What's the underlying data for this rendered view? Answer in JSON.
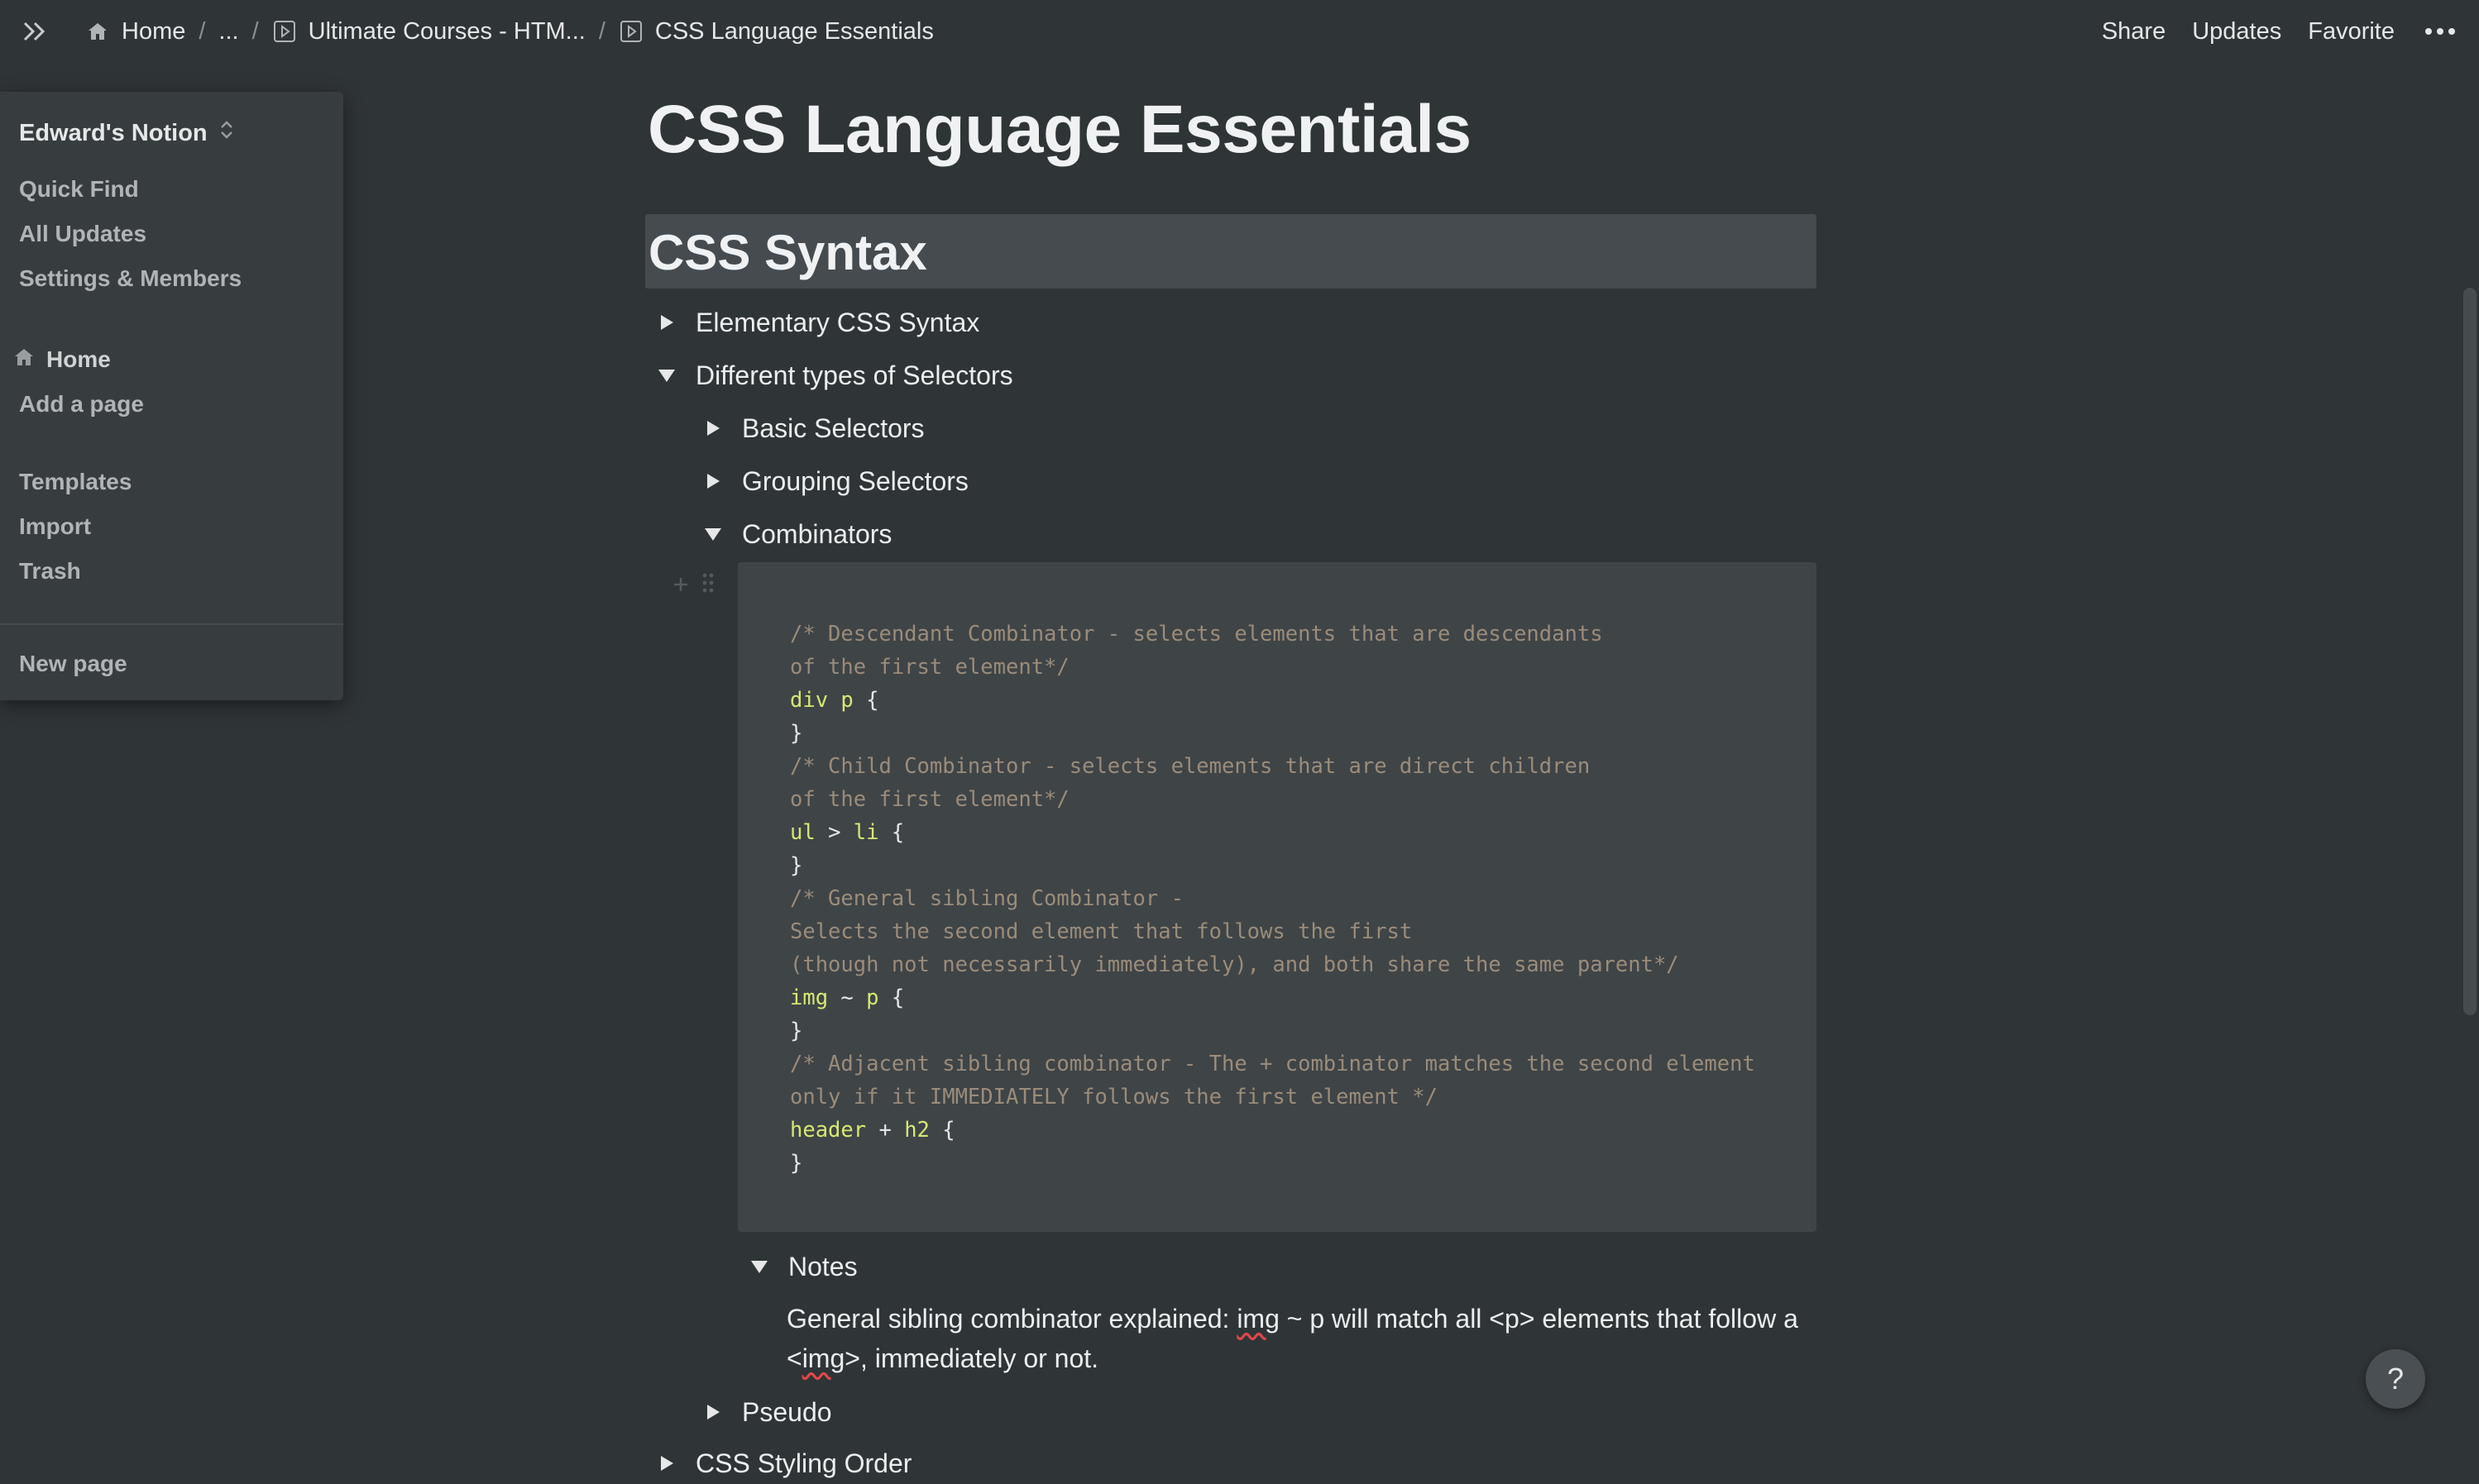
{
  "breadcrumb": {
    "home": "Home",
    "ellipsis": "...",
    "parent": "Ultimate Courses - HTM...",
    "current": "CSS Language Essentials",
    "separator": "/"
  },
  "topbar_actions": {
    "share": "Share",
    "updates": "Updates",
    "favorite": "Favorite"
  },
  "sidebar": {
    "workspace": "Edward's Notion",
    "quick_find": "Quick Find",
    "all_updates": "All Updates",
    "settings": "Settings & Members",
    "home": "Home",
    "add_page": "Add a page",
    "templates": "Templates",
    "import": "Import",
    "trash": "Trash",
    "new_page": "New page"
  },
  "page": {
    "title": "CSS Language Essentials",
    "heading": "CSS Syntax",
    "toggles": {
      "elementary": "Elementary CSS Syntax",
      "selectors": "Different types of Selectors",
      "basic": "Basic Selectors",
      "grouping": "Grouping Selectors",
      "combinators": "Combinators",
      "notes": "Notes",
      "pseudo": "Pseudo",
      "styling_order": "CSS Styling Order"
    }
  },
  "code": {
    "l1": "/* Descendant Combinator - selects elements that are descendants",
    "l2": "of the first element*/",
    "l3_sel": "div p",
    "l3_brace": " {",
    "l4": "}",
    "l5": "/* Child Combinator - selects elements that are direct children",
    "l6": "of the first element*/",
    "l7_a": "ul",
    "l7_op": " > ",
    "l7_b": "li",
    "l7_brace": " {",
    "l8": "}",
    "l9": "/* General sibling Combinator -",
    "l10": "Selects the second element that follows the first",
    "l11": "(though not necessarily immediately), and both share the same parent*/",
    "l12_a": "img",
    "l12_op": " ~ ",
    "l12_b": "p",
    "l12_brace": " {",
    "l13": "}",
    "l14": "/* Adjacent sibling combinator - The + combinator matches the second element",
    "l15": "only if it IMMEDIATELY follows the first element */",
    "l16_a": "header",
    "l16_op": " + ",
    "l16_b": "h2",
    "l16_brace": " {",
    "l17": "}"
  },
  "notes": {
    "t1": "General sibling combinator explained:  ",
    "t2": "img",
    "t3": " ~ p will match all <p> elements that follow a <",
    "t4": "img",
    "t5": ">, immediately or not."
  },
  "help": "?",
  "colors": {
    "background": "#2f3437",
    "sidebar": "#373c3f",
    "code_bg": "#3f4447",
    "heading_bg": "#454b4f",
    "comment": "#9a8c7a",
    "selector": "#d7e872"
  }
}
